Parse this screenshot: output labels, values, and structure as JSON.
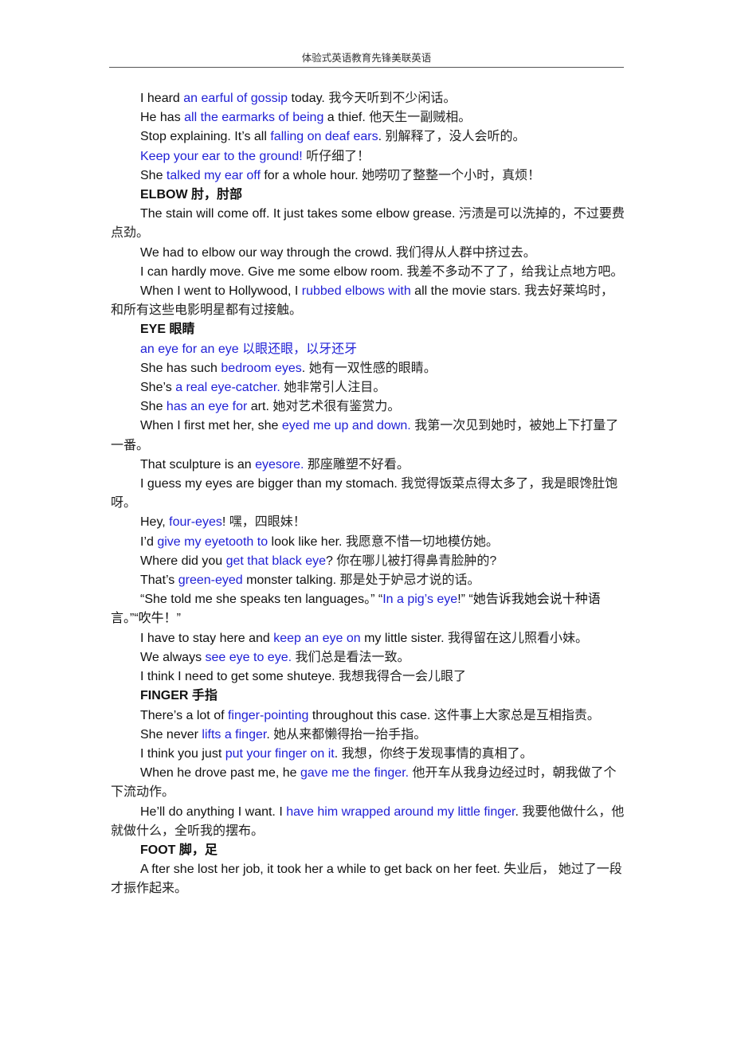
{
  "header": {
    "title": "体验式英语教育先锋美联英语"
  },
  "colors": {
    "phrase_blue": "#1f1fd6",
    "text": "#111111",
    "rule": "#555555"
  },
  "lines": [
    {
      "type": "sentence",
      "parts": [
        {
          "t": "I heard ",
          "c": "n"
        },
        {
          "t": "an earful of gossip",
          "c": "b"
        },
        {
          "t": " today.  ",
          "c": "n"
        },
        {
          "t": "我今天听到不少闲话。",
          "c": "zh"
        }
      ]
    },
    {
      "type": "sentence",
      "parts": [
        {
          "t": "He has ",
          "c": "n"
        },
        {
          "t": "all the earmarks of being",
          "c": "b"
        },
        {
          "t": " a thief.  ",
          "c": "n"
        },
        {
          "t": "他天生一副贼相。",
          "c": "zh"
        }
      ]
    },
    {
      "type": "sentence",
      "parts": [
        {
          "t": "Stop explaining. It’s all ",
          "c": "n"
        },
        {
          "t": "falling on deaf ears",
          "c": "b"
        },
        {
          "t": ".  ",
          "c": "n"
        },
        {
          "t": "别解释了，没人会听的。",
          "c": "zh"
        }
      ]
    },
    {
      "type": "sentence",
      "parts": [
        {
          "t": "Keep your ear to the ground!",
          "c": "b"
        },
        {
          "t": "  ",
          "c": "n"
        },
        {
          "t": "听仔细了！",
          "c": "zh"
        }
      ]
    },
    {
      "type": "sentence",
      "parts": [
        {
          "t": "She ",
          "c": "n"
        },
        {
          "t": "talked my ear off",
          "c": "b"
        },
        {
          "t": " for a whole hour.  ",
          "c": "n"
        },
        {
          "t": "她唠叨了整整一个小时，真烦！",
          "c": "zh"
        }
      ]
    },
    {
      "type": "heading",
      "parts": [
        {
          "t": "ELBOW  肘，肘部",
          "c": "n"
        }
      ]
    },
    {
      "type": "sentence",
      "parts": [
        {
          "t": "The stain will come off. It just takes some elbow grease.  ",
          "c": "n"
        },
        {
          "t": "污渍是可以洗掉的，不过要费点劲。",
          "c": "zh"
        }
      ]
    },
    {
      "type": "sentence",
      "parts": [
        {
          "t": "We had to elbow our way through the crowd.  ",
          "c": "n"
        },
        {
          "t": "我们得从人群中挤过去。",
          "c": "zh"
        }
      ]
    },
    {
      "type": "sentence",
      "parts": [
        {
          "t": "I can hardly move. Give me some elbow room.  ",
          "c": "n"
        },
        {
          "t": "我差不多动不了了，给我让点地方吧。",
          "c": "zh"
        }
      ]
    },
    {
      "type": "sentence",
      "parts": [
        {
          "t": "When I went to Hollywood, I ",
          "c": "n"
        },
        {
          "t": "rubbed elbows with",
          "c": "b"
        },
        {
          "t": " all the movie stars.  ",
          "c": "n"
        },
        {
          "t": "我去好莱坞时，和所有这些电影明星都有过接触。",
          "c": "zh"
        }
      ]
    },
    {
      "type": "heading",
      "parts": [
        {
          "t": "EYE  眼睛",
          "c": "n"
        }
      ]
    },
    {
      "type": "sentence",
      "parts": [
        {
          "t": "an eye for an eye  以眼还眼，以牙还牙",
          "c": "b"
        }
      ]
    },
    {
      "type": "sentence",
      "parts": [
        {
          "t": "She has such ",
          "c": "n"
        },
        {
          "t": "bedroom eyes",
          "c": "b"
        },
        {
          "t": ".  ",
          "c": "n"
        },
        {
          "t": "她有一双性感的眼睛。",
          "c": "zh"
        }
      ]
    },
    {
      "type": "sentence",
      "parts": [
        {
          "t": "She’s ",
          "c": "n"
        },
        {
          "t": "a real eye-catcher.",
          "c": "b"
        },
        {
          "t": "  ",
          "c": "n"
        },
        {
          "t": "她非常引人注目。",
          "c": "zh"
        }
      ]
    },
    {
      "type": "sentence",
      "parts": [
        {
          "t": "She ",
          "c": "n"
        },
        {
          "t": "has an eye for",
          "c": "b"
        },
        {
          "t": " art.  ",
          "c": "n"
        },
        {
          "t": "她对艺术很有鉴赏力。",
          "c": "zh"
        }
      ]
    },
    {
      "type": "sentence",
      "parts": [
        {
          "t": "When I first met her, she ",
          "c": "n"
        },
        {
          "t": "eyed me up and down.",
          "c": "b"
        },
        {
          "t": "  ",
          "c": "n"
        },
        {
          "t": "我第一次见到她时，被她上下打量了一番。",
          "c": "zh"
        }
      ]
    },
    {
      "type": "sentence",
      "parts": [
        {
          "t": "That sculpture is an ",
          "c": "n"
        },
        {
          "t": "eyesore.",
          "c": "b"
        },
        {
          "t": "  ",
          "c": "n"
        },
        {
          "t": "那座雕塑不好看。",
          "c": "zh"
        }
      ]
    },
    {
      "type": "sentence",
      "parts": [
        {
          "t": "I guess my eyes are bigger than my stomach.  ",
          "c": "n"
        },
        {
          "t": "我觉得饭菜点得太多了，我是眼馋肚饱呀。",
          "c": "zh"
        }
      ]
    },
    {
      "type": "sentence",
      "parts": [
        {
          "t": "Hey, ",
          "c": "n"
        },
        {
          "t": "four-eyes",
          "c": "b"
        },
        {
          "t": "!  ",
          "c": "n"
        },
        {
          "t": "嘿，四眼妹！",
          "c": "zh"
        }
      ]
    },
    {
      "type": "sentence",
      "parts": [
        {
          "t": "I’d ",
          "c": "n"
        },
        {
          "t": "give my eyetooth to",
          "c": "b"
        },
        {
          "t": " look like her.  ",
          "c": "n"
        },
        {
          "t": "我愿意不惜一切地模仿她。",
          "c": "zh"
        }
      ]
    },
    {
      "type": "sentence",
      "parts": [
        {
          "t": "Where did you ",
          "c": "n"
        },
        {
          "t": "get that black eye",
          "c": "b"
        },
        {
          "t": "?  ",
          "c": "n"
        },
        {
          "t": "你在哪儿被打得鼻青脸肿的?",
          "c": "zh"
        }
      ]
    },
    {
      "type": "sentence",
      "parts": [
        {
          "t": "That’s ",
          "c": "n"
        },
        {
          "t": "green-eyed",
          "c": "b"
        },
        {
          "t": " monster talking.  ",
          "c": "n"
        },
        {
          "t": "那是处于妒忌才说的话。",
          "c": "zh"
        }
      ]
    },
    {
      "type": "sentence",
      "parts": [
        {
          "t": "“She told me she speaks ten languages。”  “",
          "c": "n"
        },
        {
          "t": "In a pig’s eye",
          "c": "b"
        },
        {
          "t": "!”  “她告诉我她会说十种语言。”“吹牛！”",
          "c": "n"
        }
      ]
    },
    {
      "type": "sentence",
      "parts": [
        {
          "t": "I have to stay here and ",
          "c": "n"
        },
        {
          "t": "keep an eye on",
          "c": "b"
        },
        {
          "t": " my little sister.  ",
          "c": "n"
        },
        {
          "t": "我得留在这儿照看小妹。",
          "c": "zh"
        }
      ]
    },
    {
      "type": "sentence",
      "parts": [
        {
          "t": "We always ",
          "c": "n"
        },
        {
          "t": "see eye to eye.",
          "c": "b"
        },
        {
          "t": "  ",
          "c": "n"
        },
        {
          "t": "我们总是看法一致。",
          "c": "zh"
        }
      ]
    },
    {
      "type": "sentence",
      "parts": [
        {
          "t": "I think I need to get some shuteye.  ",
          "c": "n"
        },
        {
          "t": "我想我得合一会儿眼了",
          "c": "zh"
        }
      ]
    },
    {
      "type": "heading",
      "parts": [
        {
          "t": "FINGER  手指",
          "c": "n"
        }
      ]
    },
    {
      "type": "sentence",
      "parts": [
        {
          "t": "There’s a lot of ",
          "c": "n"
        },
        {
          "t": "finger-pointing",
          "c": "b"
        },
        {
          "t": " throughout this case.  ",
          "c": "n"
        },
        {
          "t": "这件事上大家总是互相指责。",
          "c": "zh"
        }
      ]
    },
    {
      "type": "sentence",
      "parts": [
        {
          "t": "She never ",
          "c": "n"
        },
        {
          "t": "lifts a finger",
          "c": "b"
        },
        {
          "t": ".  ",
          "c": "n"
        },
        {
          "t": "她从来都懒得抬一抬手指。",
          "c": "zh"
        }
      ]
    },
    {
      "type": "sentence",
      "parts": [
        {
          "t": "I think you just ",
          "c": "n"
        },
        {
          "t": "put your finger on it",
          "c": "b"
        },
        {
          "t": ".  ",
          "c": "n"
        },
        {
          "t": "我想，你终于发现事情的真相了。",
          "c": "zh"
        }
      ]
    },
    {
      "type": "sentence",
      "parts": [
        {
          "t": "When he drove past me, he ",
          "c": "n"
        },
        {
          "t": "gave me the finger.",
          "c": "b"
        },
        {
          "t": "  ",
          "c": "n"
        },
        {
          "t": "他开车从我身边经过时，朝我做了个下流动作。",
          "c": "zh"
        }
      ]
    },
    {
      "type": "sentence",
      "parts": [
        {
          "t": "He’ll do anything I want. I ",
          "c": "n"
        },
        {
          "t": "have him wrapped around my little finger",
          "c": "b"
        },
        {
          "t": ".  ",
          "c": "n"
        },
        {
          "t": "我要他做什么，他就做什么，全听我的摆布。",
          "c": "zh"
        }
      ]
    },
    {
      "type": "heading",
      "parts": [
        {
          "t": "FOOT  脚，足",
          "c": "n"
        }
      ]
    },
    {
      "type": "sentence",
      "parts": [
        {
          "t": "A fter she lost her job, it took her a while to get back on her feet.  ",
          "c": "n"
        },
        {
          "t": "失业后，  她过了一段才振作起来。",
          "c": "zh"
        }
      ]
    }
  ]
}
